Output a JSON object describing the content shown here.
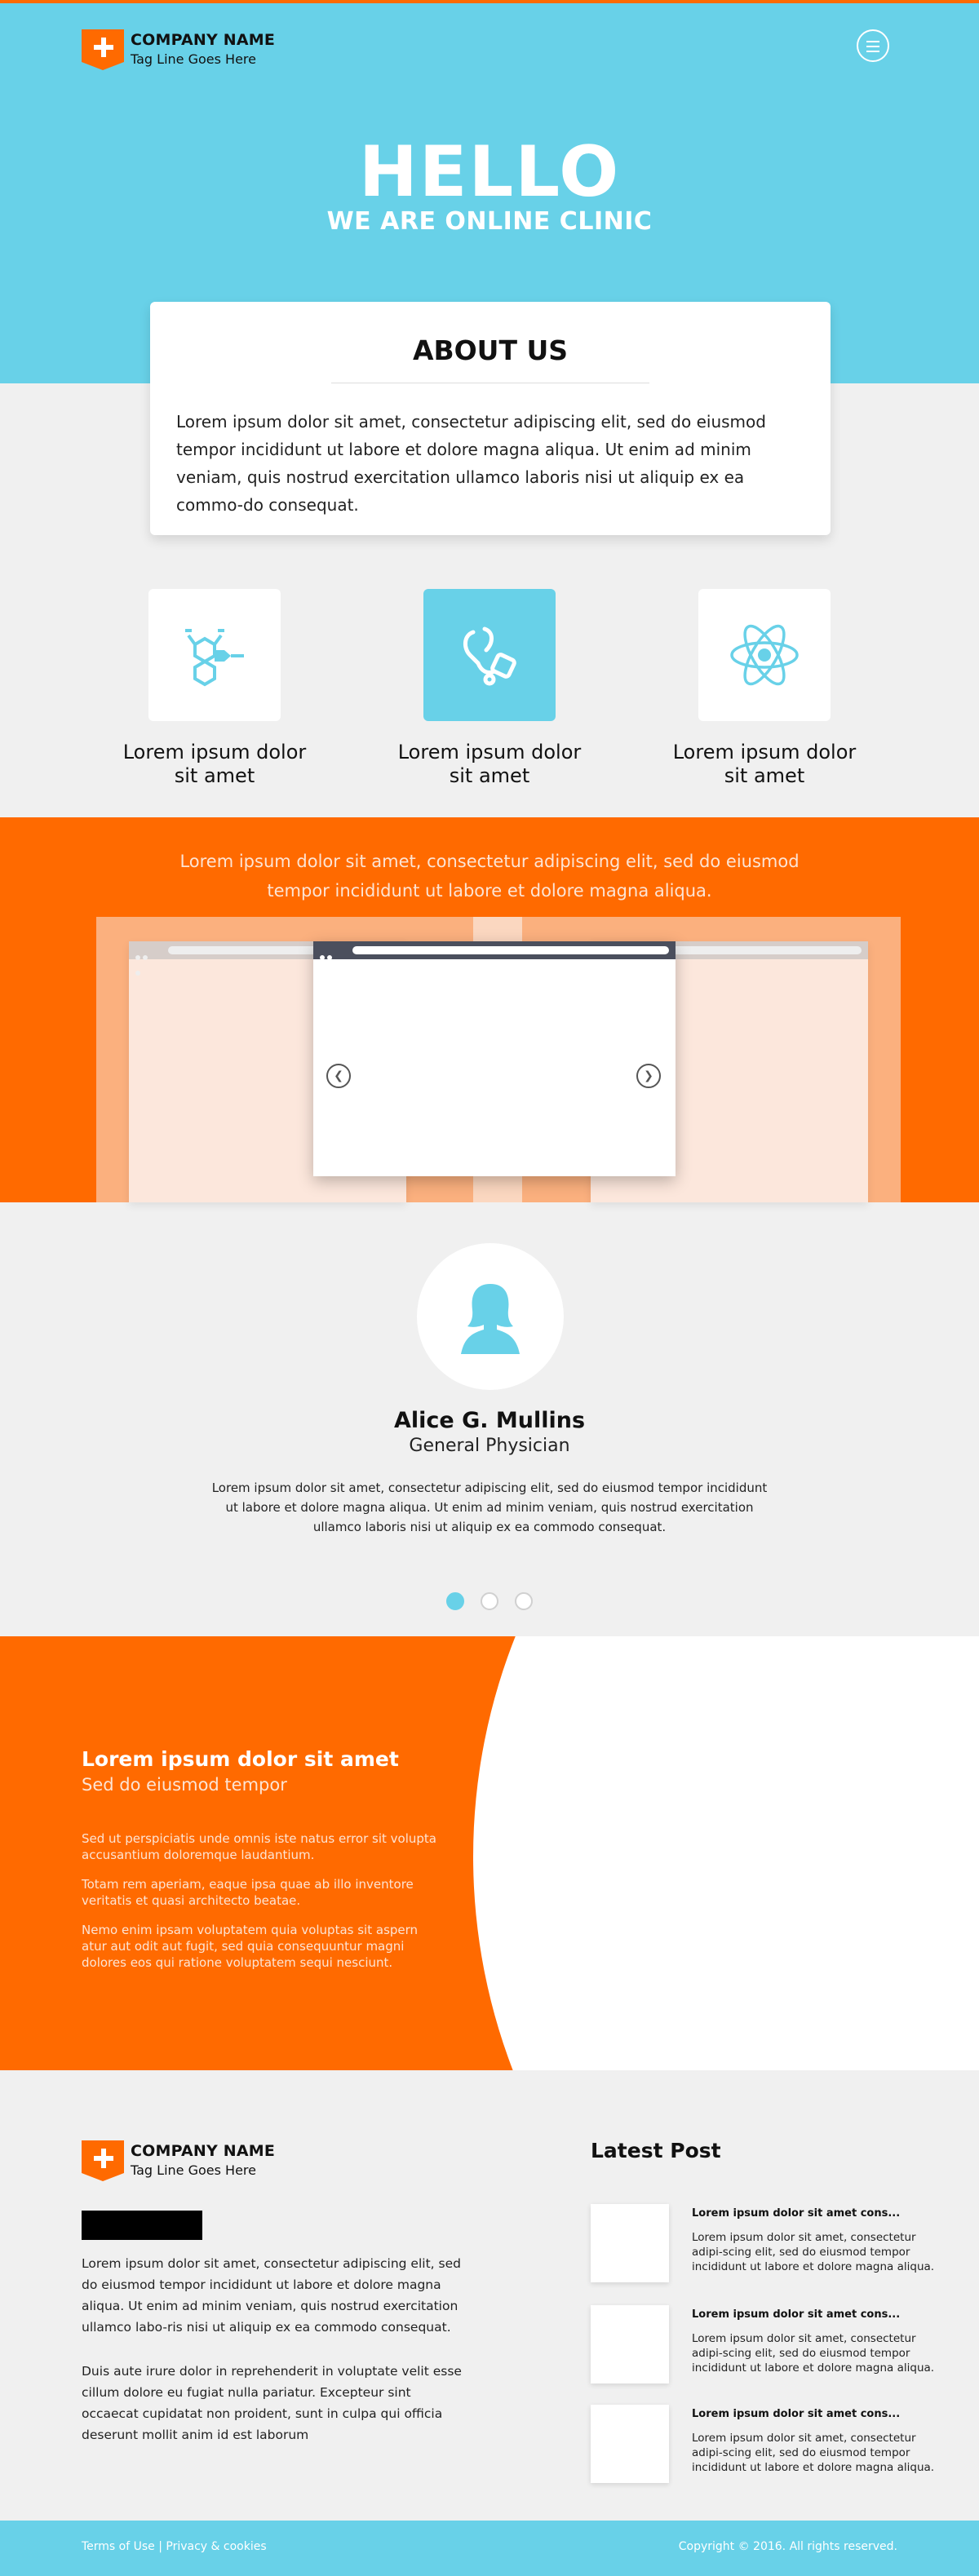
{
  "brand": {
    "name": "COMPANY NAME",
    "tagline": "Tag Line Goes Here",
    "accent_orange": "#ff6a00",
    "accent_blue": "#68d1e8"
  },
  "header": {
    "menu_icon": "hamburger-icon"
  },
  "hero": {
    "title": "HELLO",
    "subtitle": "WE ARE ONLINE CLINIC"
  },
  "about": {
    "title": "ABOUT US",
    "body": "Lorem ipsum dolor sit amet, consectetur adipiscing elit, sed do eiusmod tempor incididunt ut labore et dolore magna aliqua. Ut enim ad minim veniam, quis nostrud exercitation ullamco laboris nisi ut aliquip ex ea commo-do consequat."
  },
  "features": [
    {
      "icon": "molecule-icon",
      "label_line1": "Lorem ipsum dolor",
      "label_line2": "sit amet"
    },
    {
      "icon": "stethoscope-icon",
      "label_line1": "Lorem ipsum dolor",
      "label_line2": "sit amet"
    },
    {
      "icon": "atom-icon",
      "label_line1": "Lorem ipsum dolor",
      "label_line2": "sit amet"
    }
  ],
  "slider": {
    "intro_line1": "Lorem ipsum dolor sit amet, consectetur adipiscing elit, sed do eiusmod",
    "intro_line2": "tempor incididunt ut labore et dolore magna aliqua.",
    "prev_icon": "chevron-left-icon",
    "next_icon": "chevron-right-icon"
  },
  "testimonial": {
    "avatar_icon": "female-user-icon",
    "name": "Alice G. Mullins",
    "role": "General Physician",
    "quote": "Lorem ipsum dolor sit amet, consectetur adipiscing elit, sed do eiusmod tempor incididunt ut labore et dolore magna aliqua. Ut enim ad minim veniam, quis nostrud exercitation ullamco laboris nisi ut aliquip ex ea commodo consequat.",
    "pages": 3,
    "active_page": 1
  },
  "info": {
    "title": "Lorem ipsum dolor sit amet",
    "subtitle": "Sed do eiusmod tempor",
    "paragraphs": [
      "Sed ut perspiciatis unde omnis iste natus error sit volupta accusantium doloremque laudantium.",
      "Totam rem aperiam, eaque ipsa quae ab illo inventore veritatis et quasi architecto beatae.",
      "Nemo enim ipsam voluptatem quia voluptas sit aspern atur aut odit aut fugit, sed quia consequuntur magni dolores eos qui ratione voluptatem sequi nesciunt."
    ]
  },
  "footer": {
    "text1": "Lorem ipsum dolor sit amet, consectetur adipiscing elit, sed do eiusmod tempor incididunt ut labore et dolore magna aliqua. Ut enim ad minim veniam, quis nostrud exercitation ullamco labo-ris nisi ut aliquip ex ea commodo consequat.",
    "text2": "Duis aute irure dolor in reprehenderit in voluptate velit esse cillum dolore eu fugiat nulla pariatur. Excepteur sint occaecat cupidatat non proident, sunt in culpa qui officia deserunt mollit anim id est laborum",
    "latest_title": "Latest Post",
    "posts": [
      {
        "title": "Lorem ipsum dolor sit amet cons...",
        "body": "Lorem ipsum dolor sit amet, consectetur adipi-scing elit, sed do eiusmod tempor incididunt ut labore et dolore magna aliqua."
      },
      {
        "title": "Lorem ipsum dolor sit amet cons...",
        "body": "Lorem ipsum dolor sit amet, consectetur adipi-scing elit, sed do eiusmod tempor incididunt ut labore et dolore magna aliqua."
      },
      {
        "title": "Lorem ipsum dolor sit amet cons...",
        "body": "Lorem ipsum dolor sit amet, consectetur adipi-scing elit, sed do eiusmod tempor incididunt ut labore et dolore magna aliqua."
      }
    ]
  },
  "bottombar": {
    "terms": "Terms of Use",
    "separator": "|",
    "privacy": "Privacy & cookies",
    "copyright": "Copyright © 2016. All rights reserved."
  }
}
